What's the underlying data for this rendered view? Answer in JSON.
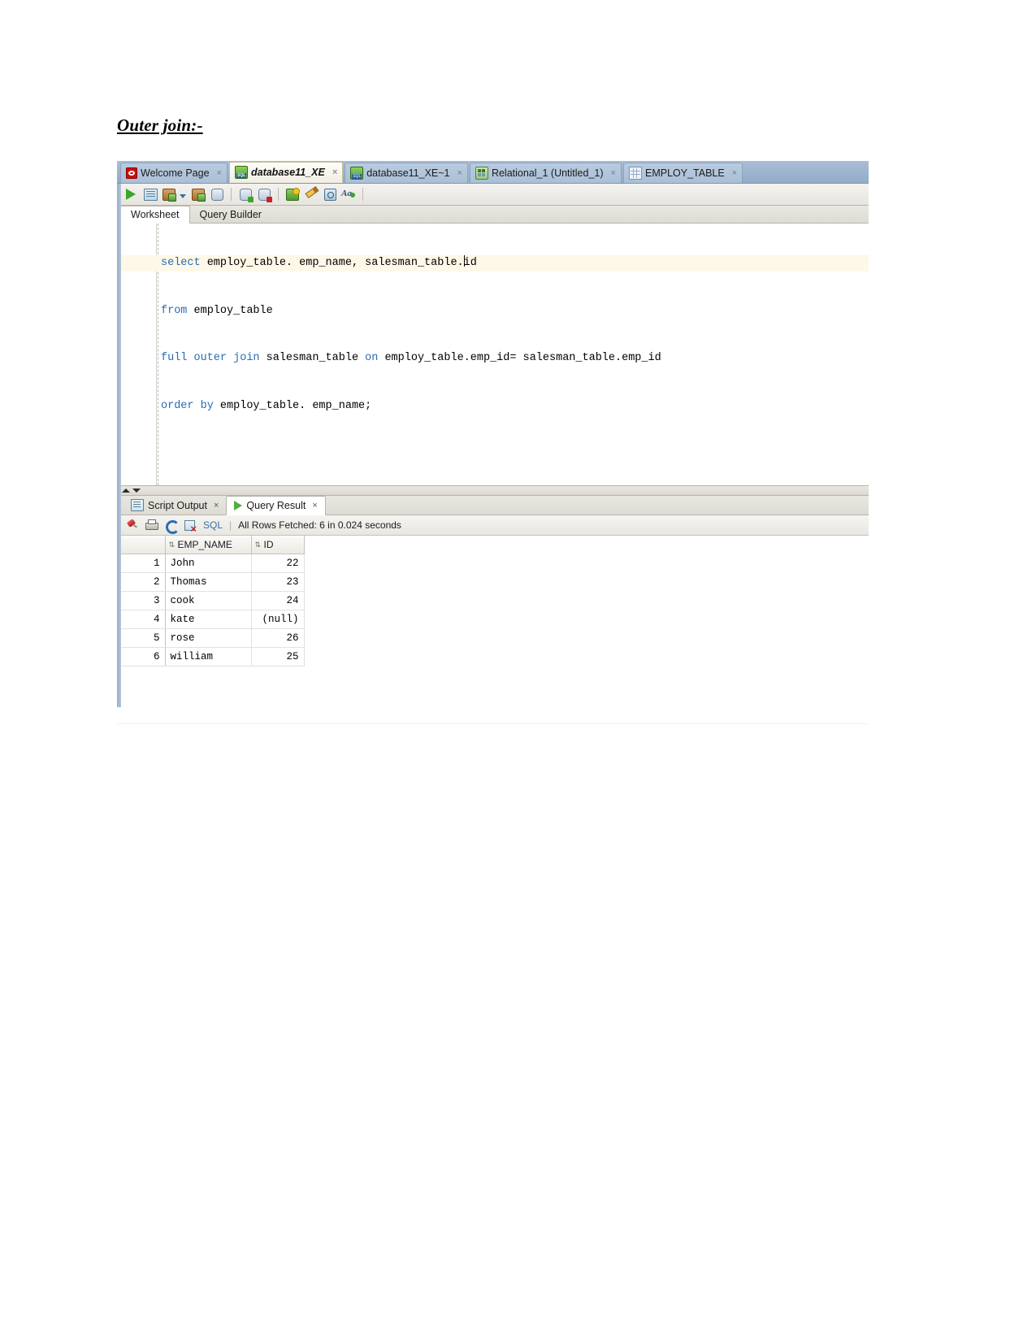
{
  "document": {
    "heading": "Outer join:-"
  },
  "app": {
    "tabs": [
      {
        "label": "Welcome Page",
        "icon": "oracle-icon",
        "active": false,
        "close": "×"
      },
      {
        "label": "database11_XE",
        "icon": "database-sql-icon",
        "active": true,
        "close": "×"
      },
      {
        "label": "database11_XE~1",
        "icon": "database-sql-icon",
        "active": false,
        "close": "×"
      },
      {
        "label": "Relational_1 (Untitled_1)",
        "icon": "relational-model-icon",
        "active": false,
        "close": "×"
      },
      {
        "label": "EMPLOY_TABLE",
        "icon": "table-icon",
        "active": false,
        "close": "×"
      }
    ],
    "toolbar": {
      "buttons": [
        {
          "name": "run-statement-button",
          "icon": "run-green-triangle-icon"
        },
        {
          "name": "run-script-button",
          "icon": "script-icon"
        },
        {
          "name": "explain-plan-button",
          "icon": "explain-plan-icon"
        },
        {
          "name": "autotrace-button",
          "icon": "autotrace-icon"
        },
        {
          "name": "commit-button",
          "icon": "commit-database-icon"
        },
        {
          "name": "rollback-button",
          "icon": "rollback-database-icon"
        },
        {
          "name": "unshared-worksheet-button",
          "icon": "unshare-worksheet-icon"
        },
        {
          "name": "clear-button",
          "icon": "pencil-eraser-icon"
        },
        {
          "name": "sql-history-button",
          "icon": "history-clock-icon"
        },
        {
          "name": "query-builder-toggle-button",
          "icon": "font-aa-icon"
        }
      ]
    },
    "worksheet_tabs": [
      {
        "label": "Worksheet",
        "active": true
      },
      {
        "label": "Query Builder",
        "active": false
      }
    ],
    "editor": {
      "lines": [
        {
          "current": true,
          "tokens": [
            {
              "t": "select",
              "kw": true
            },
            {
              "t": " employ_table. emp_name, salesman_table.",
              "kw": false
            },
            {
              "t": "│",
              "cursor": true
            },
            {
              "t": "id",
              "kw": false
            }
          ]
        },
        {
          "current": false,
          "tokens": [
            {
              "t": "from",
              "kw": true
            },
            {
              "t": " employ_table",
              "kw": false
            }
          ]
        },
        {
          "current": false,
          "tokens": [
            {
              "t": "full outer join",
              "kw": true
            },
            {
              "t": " salesman_table ",
              "kw": false
            },
            {
              "t": "on",
              "kw": true
            },
            {
              "t": " employ_table.emp_id= salesman_table.emp_id",
              "kw": false
            }
          ]
        },
        {
          "current": false,
          "tokens": [
            {
              "t": "order by",
              "kw": true
            },
            {
              "t": " employ_table. emp_name;",
              "kw": false
            }
          ]
        }
      ],
      "plain_text": "select employ_table. emp_name, salesman_table.id\nfrom employ_table\nfull outer join salesman_table on employ_table.emp_id= salesman_table.emp_id\norder by employ_table. emp_name;"
    },
    "results": {
      "tabs": [
        {
          "label": "Script Output",
          "icon": "script-output-icon",
          "active": false,
          "close": "×"
        },
        {
          "label": "Query Result",
          "icon": "query-result-play-icon",
          "active": true,
          "close": "×"
        }
      ],
      "toolbar": {
        "pin": "pin-icon",
        "print": "print-icon",
        "refresh": "refresh-icon",
        "cancel": "cancel-icon",
        "sql_label": "SQL",
        "separator": "|",
        "status": "All Rows Fetched: 6 in 0.024 seconds"
      },
      "grid": {
        "columns": [
          "EMP_NAME",
          "ID"
        ],
        "sort_glyph": "⇅",
        "rows": [
          {
            "num": "1",
            "EMP_NAME": "John",
            "ID": "22"
          },
          {
            "num": "2",
            "EMP_NAME": "Thomas",
            "ID": "23"
          },
          {
            "num": "3",
            "EMP_NAME": "cook",
            "ID": "24"
          },
          {
            "num": "4",
            "EMP_NAME": "kate",
            "ID": "(null)"
          },
          {
            "num": "5",
            "EMP_NAME": "rose",
            "ID": "26"
          },
          {
            "num": "6",
            "EMP_NAME": "william",
            "ID": "25"
          }
        ]
      }
    },
    "colors": {
      "tab_bar": "#9fb5cf",
      "active_tab": "#f6f4ec",
      "keyword": "#2b6bb5",
      "current_line": "#fdf8e8",
      "run_green": "#3aa62c",
      "sql_link": "#3b6ea5"
    }
  }
}
